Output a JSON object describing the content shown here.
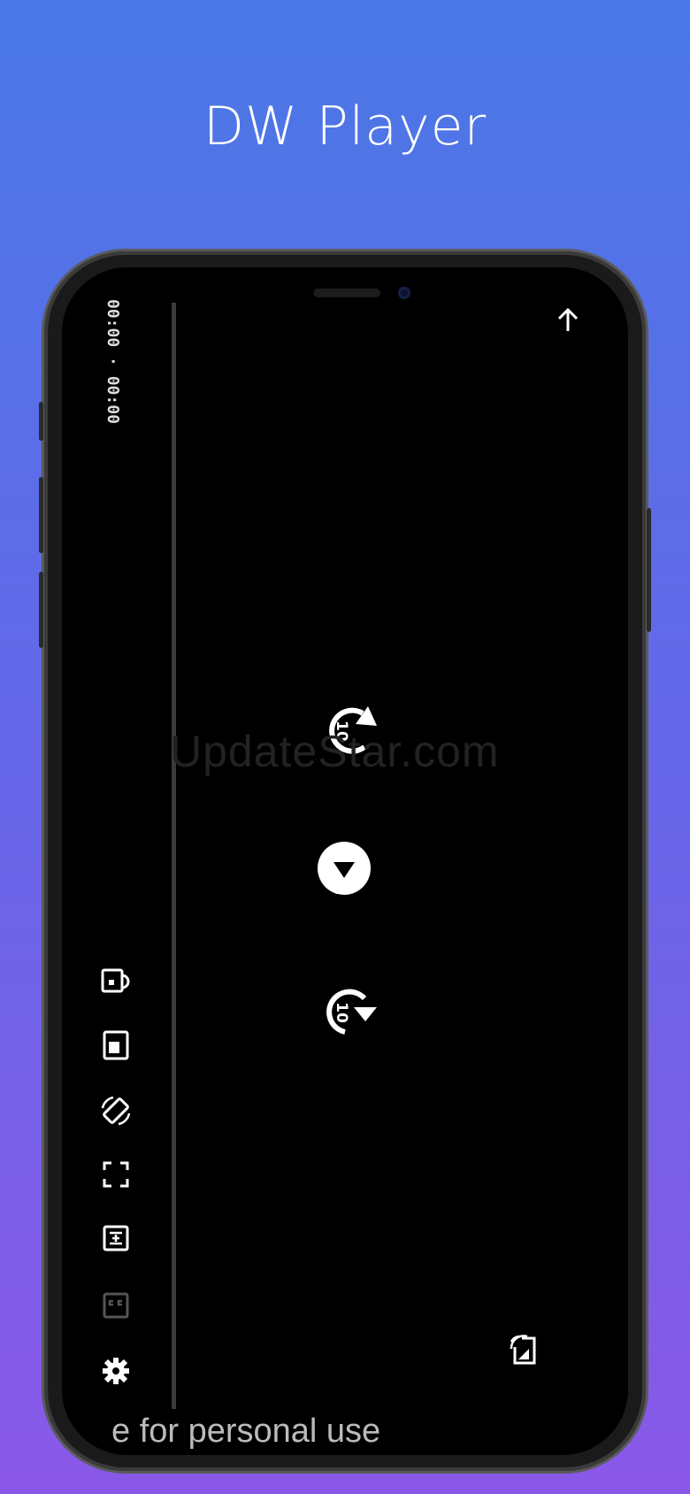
{
  "app_title": "DW Player",
  "player": {
    "current_time": "00:00",
    "total_time": "00:00",
    "time_separator": "·",
    "rewind_seconds": "10",
    "forward_seconds": "10",
    "bottom_text": "e for personal use"
  },
  "icons": {
    "top_right": "arrow-up-icon",
    "left_column": [
      "pip-icon",
      "mini-player-icon",
      "rotate-screen-icon",
      "fullscreen-icon",
      "aspect-ratio-icon",
      "closed-captions-icon",
      "settings-icon"
    ],
    "bottom_right": "cast-icon"
  },
  "watermark": "UpdateStar.com",
  "colors": {
    "background_top": "#4a78e6",
    "background_bottom": "#8a58e8",
    "screen": "#000000",
    "icon": "#ffffff"
  }
}
